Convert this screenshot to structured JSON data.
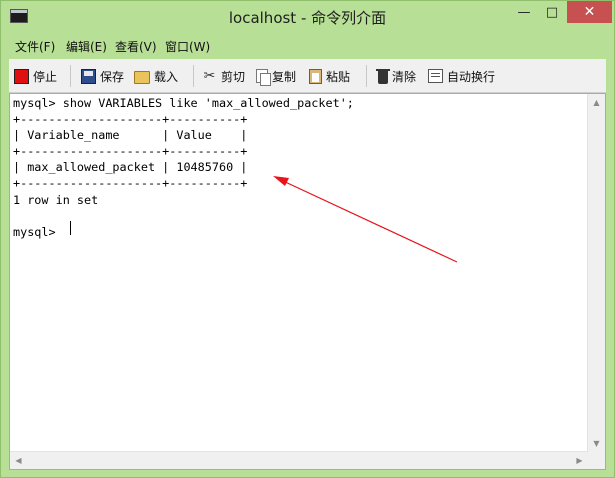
{
  "window": {
    "title": "localhost - 命令列介面",
    "minimize": "—",
    "maximize": "□",
    "close": "✕"
  },
  "menu": {
    "items": [
      "文件(F)",
      "编辑(E)",
      "查看(V)",
      "窗口(W)"
    ]
  },
  "toolbar": {
    "stop": "停止",
    "save": "保存",
    "load": "载入",
    "cut": "剪切",
    "copy": "复制",
    "paste": "粘贴",
    "clear": "清除",
    "wrap": "自动换行"
  },
  "console": {
    "lines": [
      "mysql> show VARIABLES like 'max_allowed_packet';",
      "+--------------------+----------+",
      "| Variable_name      | Value    |",
      "+--------------------+----------+",
      "| max_allowed_packet | 10485760 |",
      "+--------------------+----------+",
      "1 row in set",
      "",
      "mysql> "
    ]
  },
  "annotation": {
    "color": "#e8141a"
  }
}
